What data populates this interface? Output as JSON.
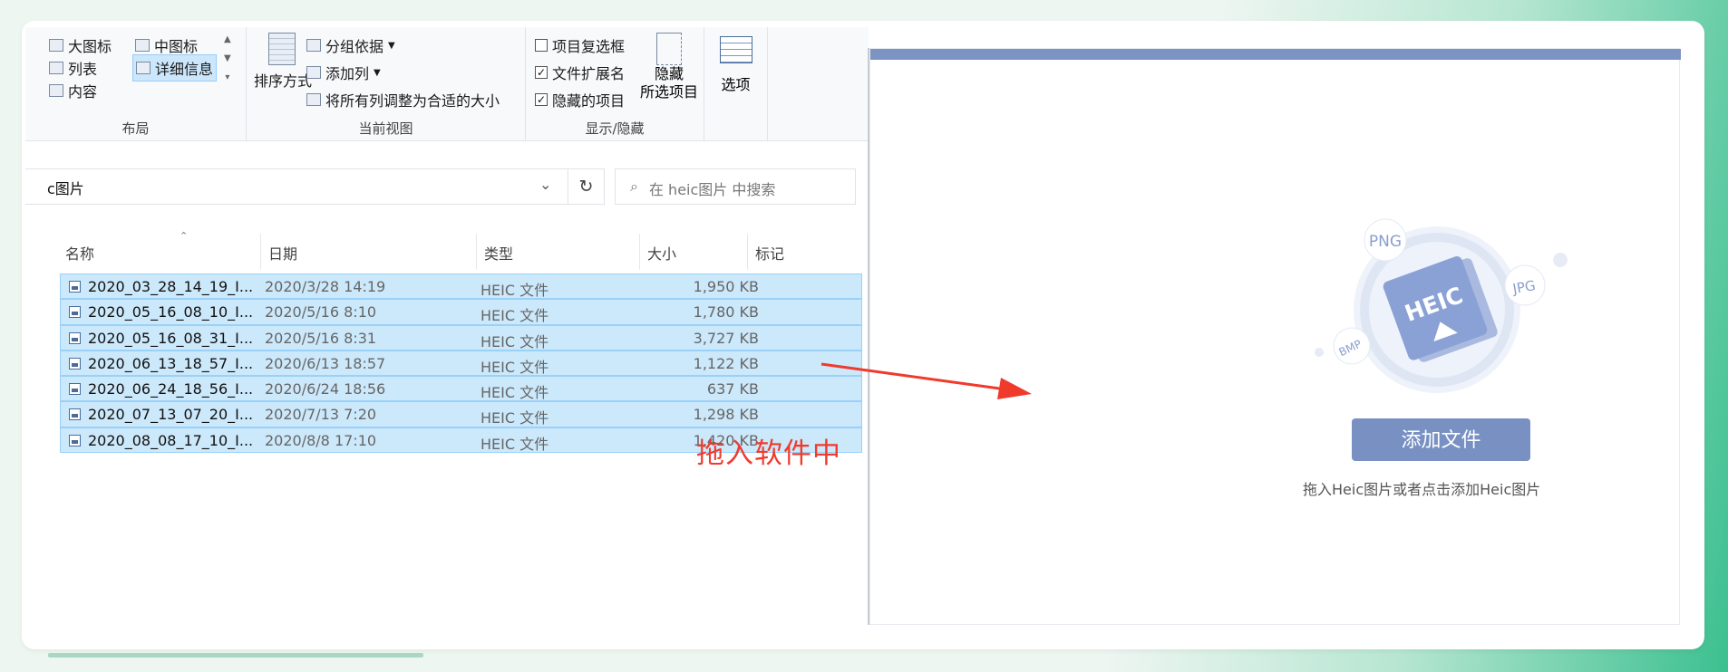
{
  "ribbon": {
    "layout": {
      "items": [
        "大图标",
        "中图标",
        "列表",
        "详细信息",
        "内容"
      ],
      "caption": "布局"
    },
    "current_view": {
      "sort_label": "排序方式",
      "group_by": "分组依据",
      "add_column": "添加列",
      "fit_columns": "将所有列调整为合适的大小",
      "caption": "当前视图"
    },
    "show_hide": {
      "item_checkboxes": {
        "label": "项目复选框",
        "checked": false
      },
      "file_extensions": {
        "label": "文件扩展名",
        "checked": true
      },
      "hidden_items": {
        "label": "隐藏的项目",
        "checked": true
      },
      "hide_selected": "隐藏\n所选项目",
      "caption": "显示/隐藏"
    },
    "options_label": "选项"
  },
  "address": {
    "path": "c图片",
    "search_placeholder": "在 heic图片 中搜索"
  },
  "columns": [
    "名称",
    "日期",
    "类型",
    "大小",
    "标记"
  ],
  "files": [
    {
      "name": "2020_03_28_14_19_I...",
      "date": "2020/3/28 14:19",
      "type": "HEIC 文件",
      "size": "1,950 KB"
    },
    {
      "name": "2020_05_16_08_10_I...",
      "date": "2020/5/16 8:10",
      "type": "HEIC 文件",
      "size": "1,780 KB"
    },
    {
      "name": "2020_05_16_08_31_I...",
      "date": "2020/5/16 8:31",
      "type": "HEIC 文件",
      "size": "3,727 KB"
    },
    {
      "name": "2020_06_13_18_57_I...",
      "date": "2020/6/13 18:57",
      "type": "HEIC 文件",
      "size": "1,122 KB"
    },
    {
      "name": "2020_06_24_18_56_I...",
      "date": "2020/6/24 18:56",
      "type": "HEIC 文件",
      "size": "637 KB"
    },
    {
      "name": "2020_07_13_07_20_I...",
      "date": "2020/7/13 7:20",
      "type": "HEIC 文件",
      "size": "1,298 KB"
    },
    {
      "name": "2020_08_08_17_10_I...",
      "date": "2020/8/8 17:10",
      "type": "HEIC 文件",
      "size": "1,420 KB"
    }
  ],
  "annotation": {
    "text": "拖入软件中",
    "color": "#f03a2c"
  },
  "converter": {
    "formats": [
      "PNG",
      "JPG",
      "BMP",
      "HEIC"
    ],
    "add_button": "添加文件",
    "hint": "拖入Heic图片或者点击添加Heic图片",
    "accent": "#7890c2"
  }
}
